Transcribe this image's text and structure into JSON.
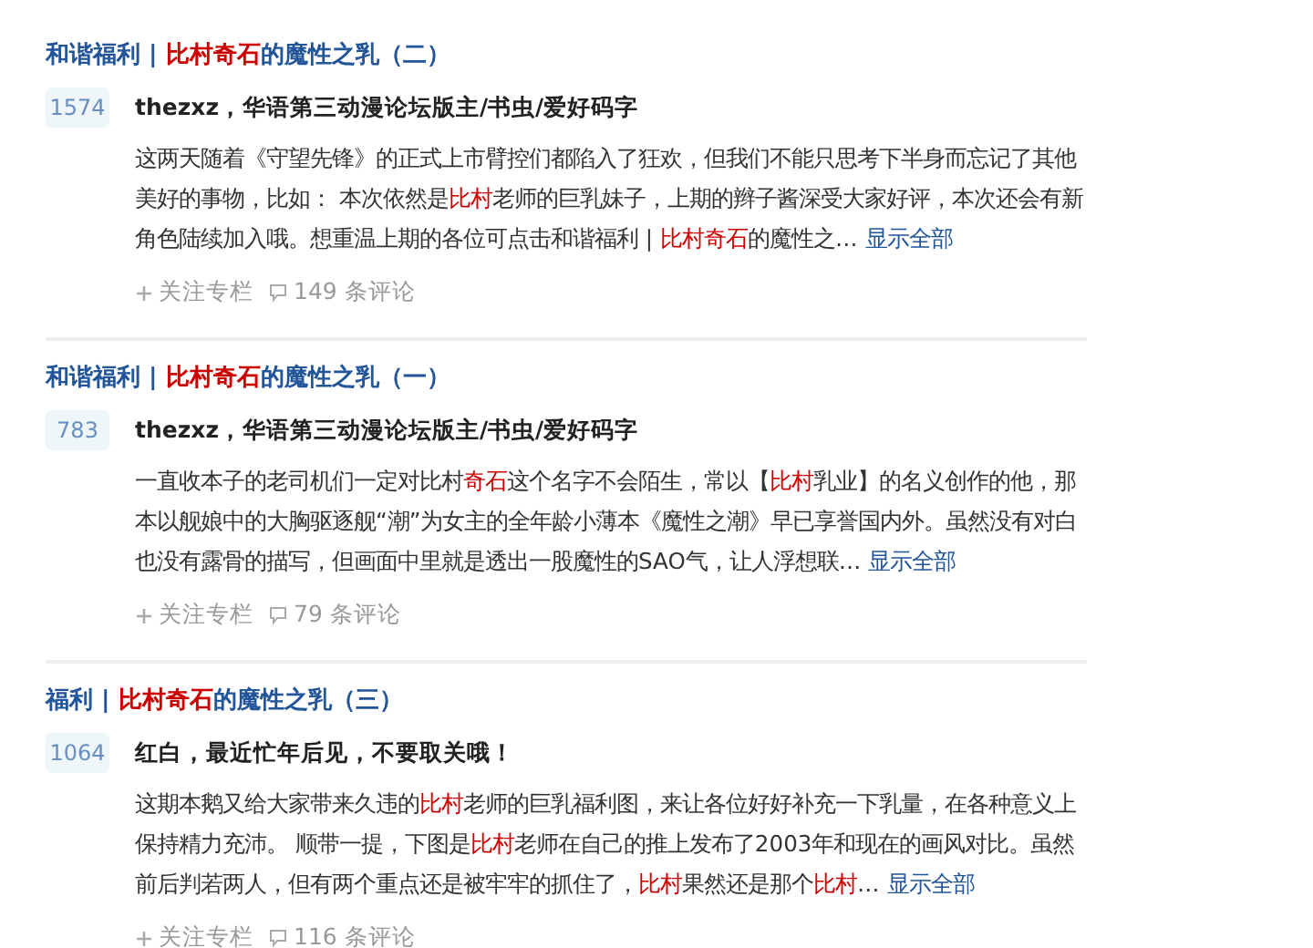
{
  "articles": [
    {
      "title": [
        {
          "text": "和谐福利 | ",
          "highlight": false
        },
        {
          "text": "比村奇石",
          "highlight": true
        },
        {
          "text": "的魔性之乳（二）",
          "highlight": false
        }
      ],
      "votes": "1574",
      "author": "thezxz，华语第三动漫论坛版主/书虫/爱好码字",
      "excerpt": [
        {
          "text": "这两天随着《守望先锋》的正式上市臂控们都陷入了狂欢，但我们不能只思考下半身而忘记了其他美好的事物，比如： 本次依然是",
          "highlight": false
        },
        {
          "text": "比村",
          "highlight": true
        },
        {
          "text": "老师的巨乳妹子，上期的辫子酱深受大家好评，本次还会有新角色陆续加入哦。想重温上期的各位可点击和谐福利 | ",
          "highlight": false
        },
        {
          "text": "比村奇石",
          "highlight": true
        },
        {
          "text": "的魔性之…",
          "highlight": false
        }
      ],
      "more": "显示全部",
      "follow": "关注专栏",
      "comments": "149 条评论"
    },
    {
      "title": [
        {
          "text": "和谐福利 | ",
          "highlight": false
        },
        {
          "text": "比村奇石",
          "highlight": true
        },
        {
          "text": "的魔性之乳（一）",
          "highlight": false
        }
      ],
      "votes": "783",
      "author": "thezxz，华语第三动漫论坛版主/书虫/爱好码字",
      "excerpt": [
        {
          "text": "一直收本子的老司机们一定对比村",
          "highlight": false
        },
        {
          "text": "奇石",
          "highlight": true
        },
        {
          "text": "这个名字不会陌生，常以【",
          "highlight": false
        },
        {
          "text": "比村",
          "highlight": true
        },
        {
          "text": "乳业】的名义创作的他，那本以舰娘中的大胸驱逐舰“潮”为女主的全年龄小薄本《魔性之潮》早已享誉国内外。虽然没有对白也没有露骨的描写，但画面中里就是透出一股魔性的SAO气，让人浮想联…",
          "highlight": false
        }
      ],
      "more": "显示全部",
      "follow": "关注专栏",
      "comments": "79 条评论"
    },
    {
      "title": [
        {
          "text": "福利 | ",
          "highlight": false
        },
        {
          "text": "比村奇石",
          "highlight": true
        },
        {
          "text": "的魔性之乳（三）",
          "highlight": false
        }
      ],
      "votes": "1064",
      "author": "红白，最近忙年后见，不要取关哦！",
      "excerpt": [
        {
          "text": "这期本鹅又给大家带来久违的",
          "highlight": false
        },
        {
          "text": "比村",
          "highlight": true
        },
        {
          "text": "老师的巨乳福利图，来让各位好好补充一下乳量，在各种意义上保持精力充沛。 顺带一提，下图是",
          "highlight": false
        },
        {
          "text": "比村",
          "highlight": true
        },
        {
          "text": "老师在自己的推上发布了2003年和现在的画风对比。虽然前后判若两人，但有两个重点还是被牢牢的抓住了，",
          "highlight": false
        },
        {
          "text": "比村",
          "highlight": true
        },
        {
          "text": "果然还是那个",
          "highlight": false
        },
        {
          "text": "比村",
          "highlight": true
        },
        {
          "text": "…",
          "highlight": false
        }
      ],
      "more": "显示全部",
      "follow": "关注专栏",
      "comments": "116 条评论"
    }
  ]
}
